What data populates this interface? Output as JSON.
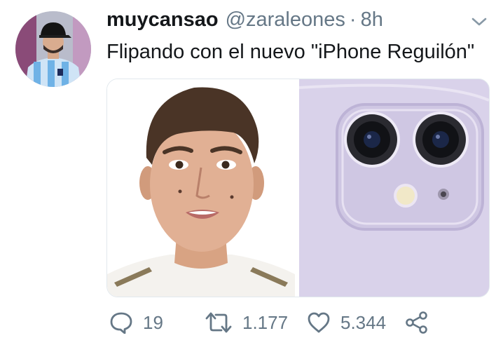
{
  "tweet": {
    "display_name": "muycansao",
    "handle": "@zaraleones",
    "separator": "·",
    "time": "8h",
    "text": "Flipando con el nuevo \"iPhone Reguilón\""
  },
  "icons": {
    "caret": "chevron-down-icon",
    "reply": "reply-icon",
    "retweet": "retweet-icon",
    "like": "heart-icon",
    "share": "share-icon"
  },
  "actions": {
    "reply_count": "19",
    "retweet_count": "1.177",
    "like_count": "5.344"
  },
  "colors": {
    "text_primary": "#14171a",
    "text_secondary": "#657786",
    "phone_body": "#d9d2ea"
  }
}
